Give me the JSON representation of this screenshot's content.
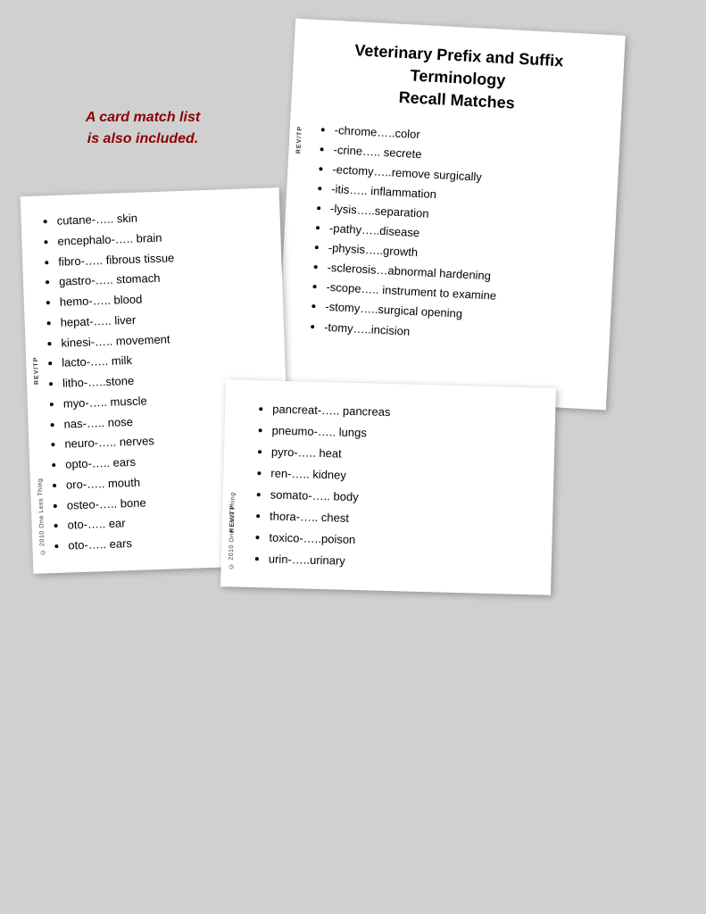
{
  "annotation": {
    "line1": "A card match list",
    "line2": "is also included."
  },
  "card_title": {
    "title_line1": "Veterinary Prefix and Suffix",
    "title_line2": "Terminology",
    "title_line3": "Recall Matches",
    "revtp": "REV/TP",
    "items": [
      "-chrome…..color",
      "-crine….. secrete",
      "-ectomy…..remove surgically",
      "-itis….. inflammation",
      "-lysis…..separation",
      "-pathy…..disease",
      "-physis…..growth",
      "-sclerosis…abnormal hardening",
      "-scope….. instrument to examine",
      "-stomy…..surgical opening",
      "-tomy…..incision"
    ]
  },
  "card_left": {
    "revtp": "REV/TP",
    "copyright": "© 2010 One Less Thing",
    "items": [
      "cutane-….. skin",
      "encephalo-….. brain",
      "fibro-….. fibrous tissue",
      "gastro-….. stomach",
      "hemo-….. blood",
      "hepat-….. liver",
      "kinesi-….. movement",
      "lacto-….. milk",
      "litho-…..stone",
      "myo-….. muscle",
      "nas-….. nose",
      "neuro-….. nerves",
      "opto-….. ears",
      "oro-….. mouth",
      "osteo-….. bone",
      "oto-….. ear",
      "oto-….. ears"
    ]
  },
  "card_bottom": {
    "revtp": "REV/TP",
    "copyright": "© 2010 One Less Thing",
    "items": [
      "pancreat-….. pancreas",
      "pneumo-….. lungs",
      "pyro-….. heat",
      "ren-….. kidney",
      "somato-….. body",
      "thora-….. chest",
      "toxico-…..poison",
      "urin-…..urinary"
    ]
  }
}
